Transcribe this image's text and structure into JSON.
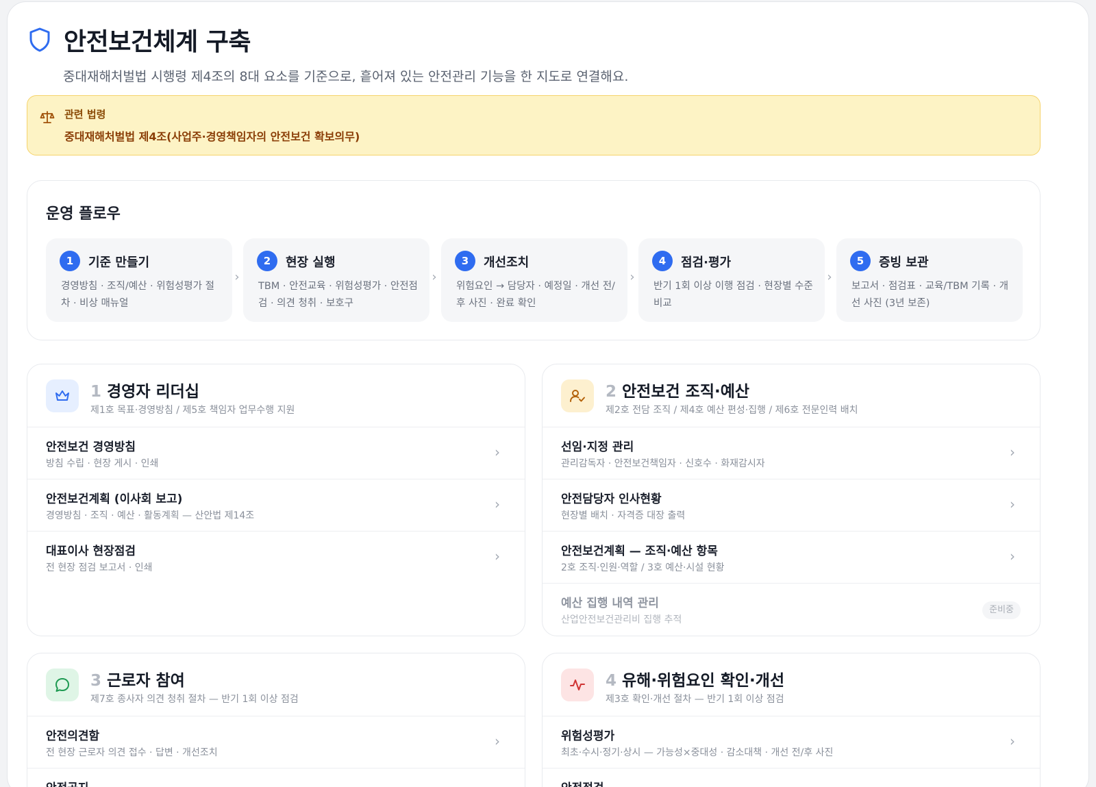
{
  "header": {
    "title": "안전보건체계 구축",
    "subtitle": "중대재해처벌법 시행령 제4조의 8대 요소를 기준으로, 흩어져 있는 안전관리 기능을 한 지도로 연결해요."
  },
  "law": {
    "label": "관련 법령",
    "text": "중대재해처벌법 제4조(사업주·경영책임자의 안전보건 확보의무)"
  },
  "flow": {
    "title": "운영 플로우",
    "steps": [
      {
        "num": "1",
        "title": "기준 만들기",
        "desc": "경영방침 · 조직/예산 · 위험성평가 절차 · 비상 매뉴얼"
      },
      {
        "num": "2",
        "title": "현장 실행",
        "desc": "TBM · 안전교육 · 위험성평가 · 안전점검 · 의견 청취 · 보호구"
      },
      {
        "num": "3",
        "title": "개선조치",
        "desc": "위험요인 → 담당자 · 예정일 · 개선 전/후 사진 · 완료 확인"
      },
      {
        "num": "4",
        "title": "점검·평가",
        "desc": "반기 1회 이상 이행 점검 · 현장별 수준 비교"
      },
      {
        "num": "5",
        "title": "증빙 보관",
        "desc": "보고서 · 점검표 · 교육/TBM 기록 · 개선 사진 (3년 보존)"
      }
    ]
  },
  "sections": [
    {
      "no": "1",
      "title": "경영자 리더십",
      "sub": "제1호 목표·경영방침 / 제5호 책임자 업무수행 지원",
      "icon": "crown-icon",
      "rows": [
        {
          "title": "안전보건 경영방침",
          "desc": "방침 수립 · 현장 게시 · 인쇄"
        },
        {
          "title": "안전보건계획 (이사회 보고)",
          "desc": "경영방침 · 조직 · 예산 · 활동계획 — 산안법 제14조"
        },
        {
          "title": "대표이사 현장점검",
          "desc": "전 현장 점검 보고서 · 인쇄"
        }
      ]
    },
    {
      "no": "2",
      "title": "안전보건 조직·예산",
      "sub": "제2호 전담 조직 / 제4호 예산 편성·집행 / 제6호 전문인력 배치",
      "icon": "user-check-icon",
      "rows": [
        {
          "title": "선임·지정 관리",
          "desc": "관리감독자 · 안전보건책임자 · 신호수 · 화재감시자"
        },
        {
          "title": "안전담당자 인사현황",
          "desc": "현장별 배치 · 자격증 대장 출력"
        },
        {
          "title": "안전보건계획 — 조직·예산 항목",
          "desc": "2호 조직·인원·역할 / 3호 예산·시설 현황"
        },
        {
          "title": "예산 집행 내역 관리",
          "desc": "산업안전보건관리비 집행 추적",
          "badge": "준비중"
        }
      ]
    },
    {
      "no": "3",
      "title": "근로자 참여",
      "sub": "제7호 종사자 의견 청취 절차 — 반기 1회 이상 점검",
      "icon": "chat-icon",
      "rows": [
        {
          "title": "안전의견함",
          "desc": "전 현장 근로자 의견 접수 · 답변 · 개선조치"
        },
        {
          "title": "안전공지",
          "desc": ""
        }
      ]
    },
    {
      "no": "4",
      "title": "유해·위험요인 확인·개선",
      "sub": "제3호 확인·개선 절차 — 반기 1회 이상 점검",
      "icon": "pulse-icon",
      "rows": [
        {
          "title": "위험성평가",
          "desc": "최초·수시·정기·상시 — 가능성×중대성 · 감소대책 · 개선 전/후 사진"
        },
        {
          "title": "안전점검",
          "desc": ""
        }
      ]
    }
  ],
  "colors": {
    "accent": "#2f6cf0",
    "law_bg": "#fdf3c5",
    "law_text": "#8a3d06"
  }
}
